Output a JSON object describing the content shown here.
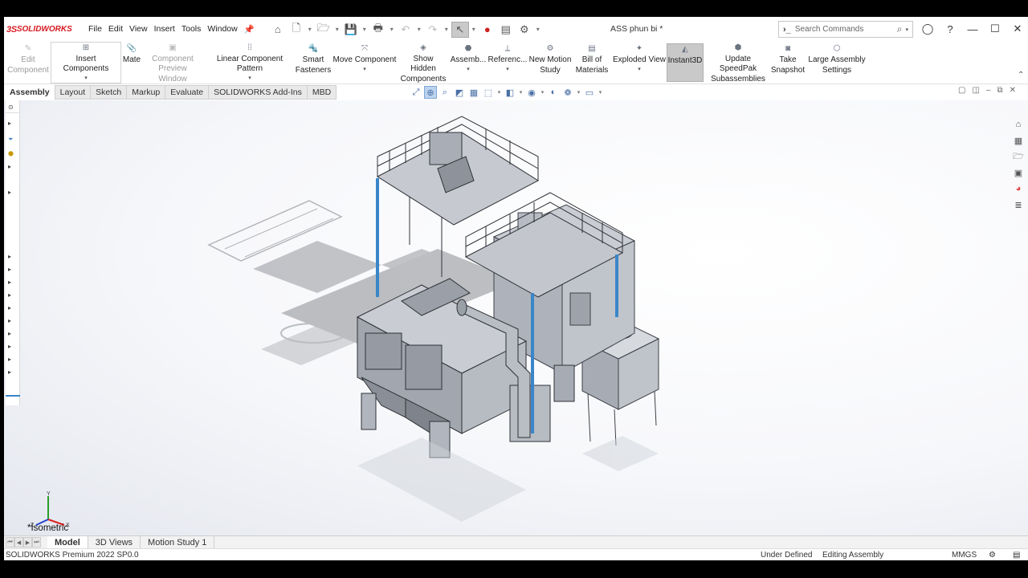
{
  "app": {
    "brand_ds": "3S",
    "brand_name": "SOLIDWORKS",
    "doc_title": "ASS phun bi *"
  },
  "menu": [
    "File",
    "Edit",
    "View",
    "Insert",
    "Tools",
    "Window"
  ],
  "search": {
    "placeholder": "Search Commands"
  },
  "ribbon": [
    {
      "label": "Edit\nComponent",
      "icon": "edit-component-icon",
      "disabled": true
    },
    {
      "label": "Insert Components",
      "icon": "insert-components-icon"
    },
    {
      "label": "Mate",
      "icon": "mate-icon"
    },
    {
      "label": "Component\nPreview Window",
      "icon": "preview-window-icon",
      "disabled": true
    },
    {
      "label": "Linear Component Pattern",
      "icon": "linear-pattern-icon"
    },
    {
      "label": "Smart\nFasteners",
      "icon": "smart-fasteners-icon"
    },
    {
      "label": "Move Component",
      "icon": "move-component-icon"
    },
    {
      "label": "Show Hidden\nComponents",
      "icon": "show-hidden-icon"
    },
    {
      "label": "Assemb...",
      "icon": "assembly-features-icon"
    },
    {
      "label": "Referenc...",
      "icon": "reference-geometry-icon"
    },
    {
      "label": "New Motion\nStudy",
      "icon": "motion-study-icon"
    },
    {
      "label": "Bill of\nMaterials",
      "icon": "bom-icon"
    },
    {
      "label": "Exploded View",
      "icon": "exploded-view-icon"
    },
    {
      "label": "Instant3D",
      "icon": "instant3d-icon",
      "active": true
    },
    {
      "label": "Update SpeedPak\nSubassemblies",
      "icon": "speedpak-icon"
    },
    {
      "label": "Take\nSnapshot",
      "icon": "snapshot-icon"
    },
    {
      "label": "Large Assembly\nSettings",
      "icon": "large-assembly-icon"
    }
  ],
  "tabs": [
    "Assembly",
    "Layout",
    "Sketch",
    "Markup",
    "Evaluate",
    "SOLIDWORKS Add-Ins",
    "MBD"
  ],
  "view": {
    "orientation_label": "*Isometric",
    "triad": {
      "x": "X",
      "y": "Y",
      "z": "Z"
    }
  },
  "bottom_tabs": [
    "Model",
    "3D Views",
    "Motion Study 1"
  ],
  "status": {
    "product": "SOLIDWORKS Premium 2022 SP0.0",
    "definition": "Under Defined",
    "mode": "Editing Assembly",
    "units": "MMGS"
  },
  "colors": {
    "accent_red": "#d71920",
    "steel": "#b7bcc4",
    "blue_pipe": "#3a86c8",
    "active_button": "#c9c9c9"
  }
}
